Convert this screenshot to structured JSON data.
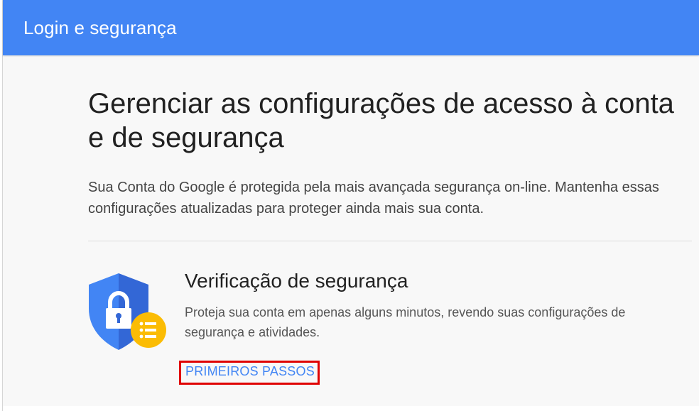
{
  "header": {
    "title": "Login e segurança"
  },
  "main": {
    "title": "Gerenciar as configurações de acesso à conta e de segurança",
    "description": "Sua Conta do Google é protegida pela mais avançada segurança on-line. Mantenha essas configurações atualizadas para proteger ainda mais sua conta."
  },
  "security_checkup": {
    "icon": "shield-lock-icon",
    "badge_icon": "list-icon",
    "title": "Verificação de segurança",
    "description": "Proteja sua conta em apenas alguns minutos, revendo suas configurações de segurança e atividades.",
    "cta_label": "PRIMEIROS PASSOS"
  },
  "colors": {
    "header_bg": "#4285f4",
    "shield_blue": "#4285f4",
    "shield_dark": "#3367d6",
    "badge_yellow": "#fbbc04",
    "highlight_red": "#e00000",
    "link_blue": "#4285f4"
  }
}
